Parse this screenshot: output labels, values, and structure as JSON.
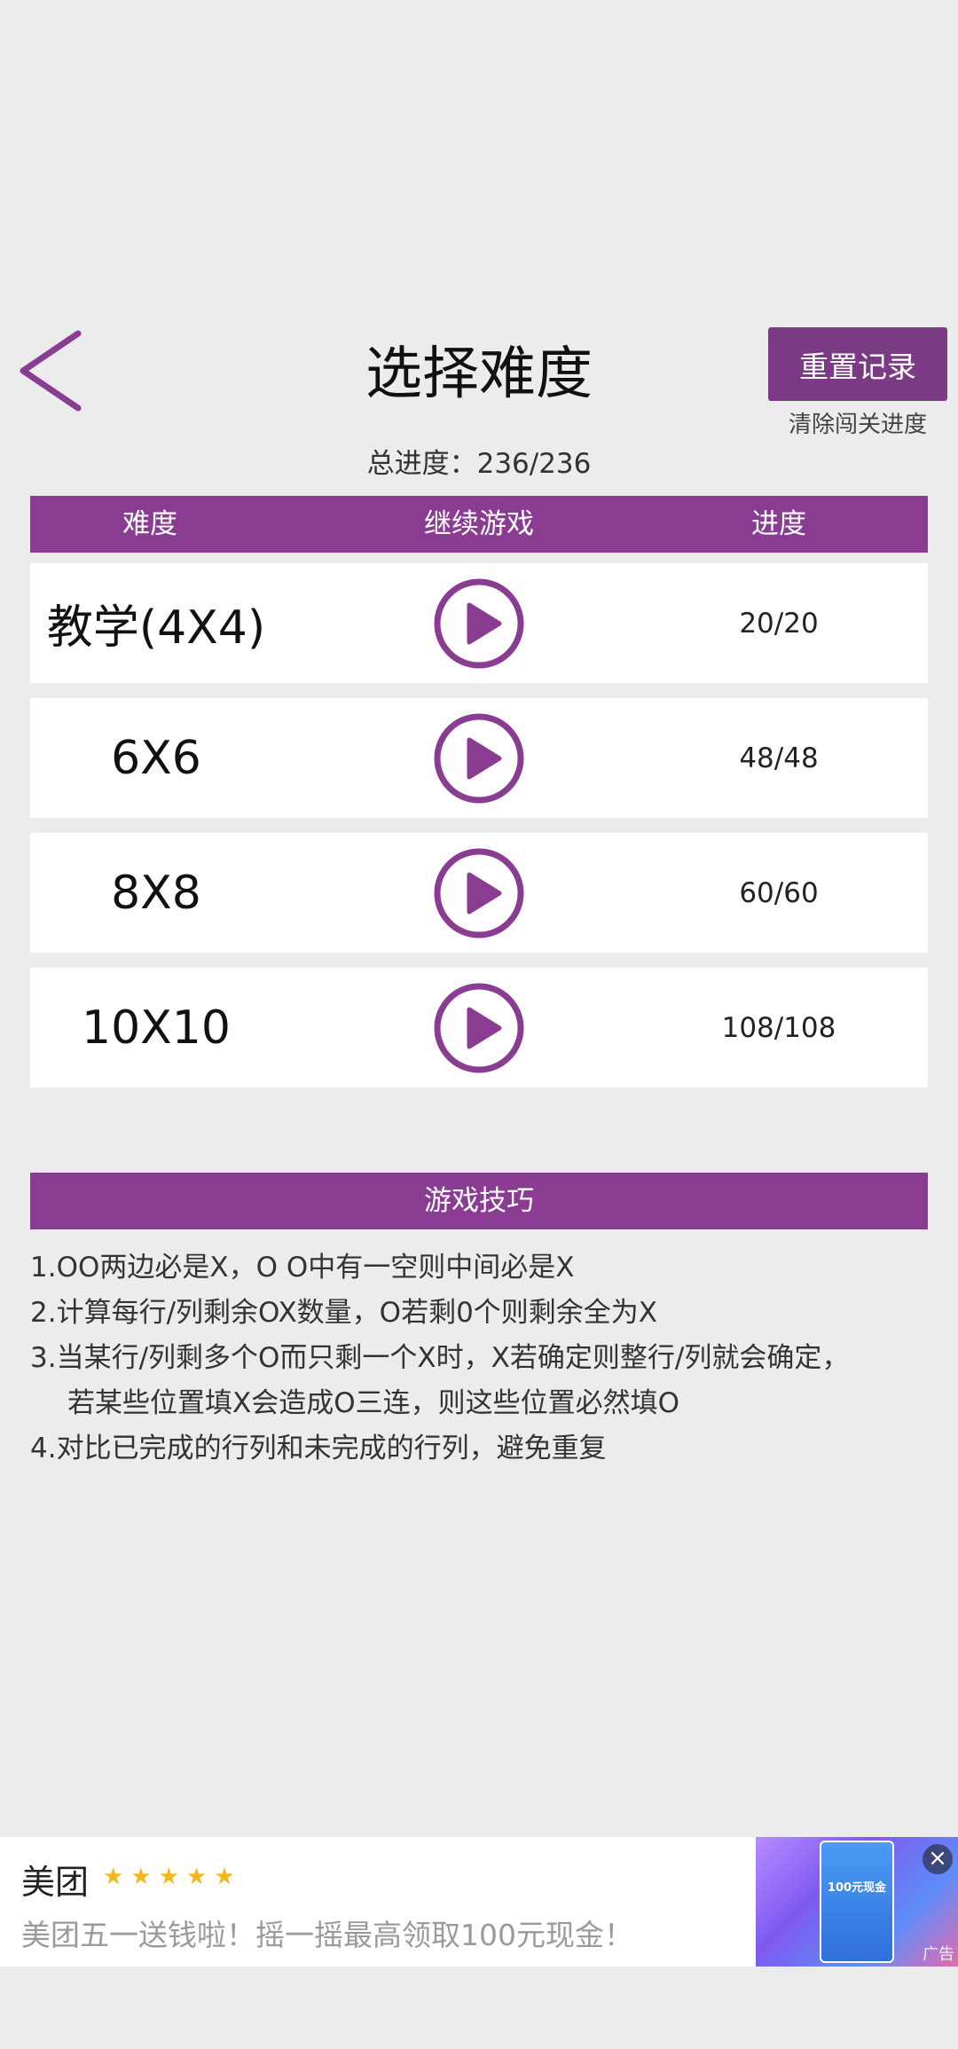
{
  "header": {
    "title": "选择难度",
    "reset_button": "重置记录",
    "reset_subtitle": "清除闯关进度",
    "total_progress": "总进度：236/236"
  },
  "table": {
    "columns": [
      "难度",
      "继续游戏",
      "进度"
    ],
    "rows": [
      {
        "name": "教学(4X4)",
        "progress": "20/20"
      },
      {
        "name": "6X6",
        "progress": "48/48"
      },
      {
        "name": "8X8",
        "progress": "60/60"
      },
      {
        "name": "10X10",
        "progress": "108/108"
      }
    ]
  },
  "tips": {
    "title": "游戏技巧",
    "lines": [
      "1.OO两边必是X，O O中有一空则中间必是X",
      "2.计算每行/列剩余OX数量，O若剩0个则剩余全为X",
      "3.当某行/列剩多个O而只剩一个X时，X若确定则整行/列就会确定，",
      "若某些位置填X会造成O三连，则这些位置必然填O",
      "4.对比已完成的行列和未完成的行列，避免重复"
    ]
  },
  "ad": {
    "brand": "美团",
    "stars": "★★★★★",
    "text": "美团五一送钱啦！摇一摇最高领取100元现金！",
    "image_text": "100元现金",
    "label": "广告",
    "close": "×"
  },
  "colors": {
    "accent": "#8a3c92",
    "button": "#7b3b84",
    "background": "#ececec"
  }
}
